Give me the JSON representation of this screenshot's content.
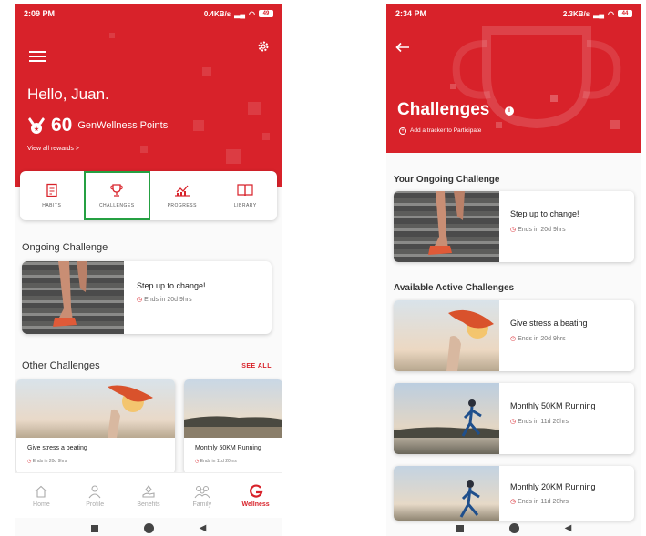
{
  "screen1": {
    "status": {
      "time": "2:09 PM",
      "net": "0.4KB/s",
      "battery": "49"
    },
    "greeting": "Hello, Juan.",
    "points_value": "60",
    "points_label": "GenWellness Points",
    "view_rewards": "View all rewards >",
    "tabs": [
      "HABITS",
      "CHALLENGES",
      "PROGRESS",
      "LIBRARY"
    ],
    "ongoing_title": "Ongoing Challenge",
    "ongoing_card": {
      "title": "Step up to change!",
      "ends": "Ends in 20d 9hrs"
    },
    "other_title": "Other Challenges",
    "see_all": "SEE ALL",
    "other_cards": [
      {
        "title": "Give stress a beating",
        "ends": "Ends in 20d 9hrs"
      },
      {
        "title": "Monthly 50KM Running",
        "ends": "Ends in 11d 20hrs"
      }
    ],
    "bottom_nav": [
      "Home",
      "Profile",
      "Benefits",
      "Family",
      "Wellness"
    ]
  },
  "screen2": {
    "status": {
      "time": "2:34 PM",
      "net": "2.3KB/s",
      "battery": "44"
    },
    "title": "Challenges",
    "add_tracker": "Add a tracker to Participate",
    "ongoing_title": "Your Ongoing Challenge",
    "ongoing_card": {
      "title": "Step up to change!",
      "ends": "Ends in 20d 9hrs"
    },
    "available_title": "Available Active Challenges",
    "available_cards": [
      {
        "title": "Give stress a beating",
        "ends": "Ends in 20d 9hrs"
      },
      {
        "title": "Monthly 50KM Running",
        "ends": "Ends in 11d 20hrs"
      },
      {
        "title": "Monthly 20KM Running",
        "ends": "Ends in 11d 20hrs"
      }
    ]
  },
  "colors": {
    "brand_red": "#d8222a",
    "highlight_green": "#25a042"
  },
  "icons": [
    "menu-icon",
    "gear-icon",
    "medal-icon",
    "habits-icon",
    "trophy-icon",
    "progress-icon",
    "library-icon",
    "clock-icon",
    "home-icon",
    "profile-icon",
    "benefits-icon",
    "family-icon",
    "wellness-icon",
    "back-arrow-icon",
    "info-icon",
    "plus-icon"
  ]
}
